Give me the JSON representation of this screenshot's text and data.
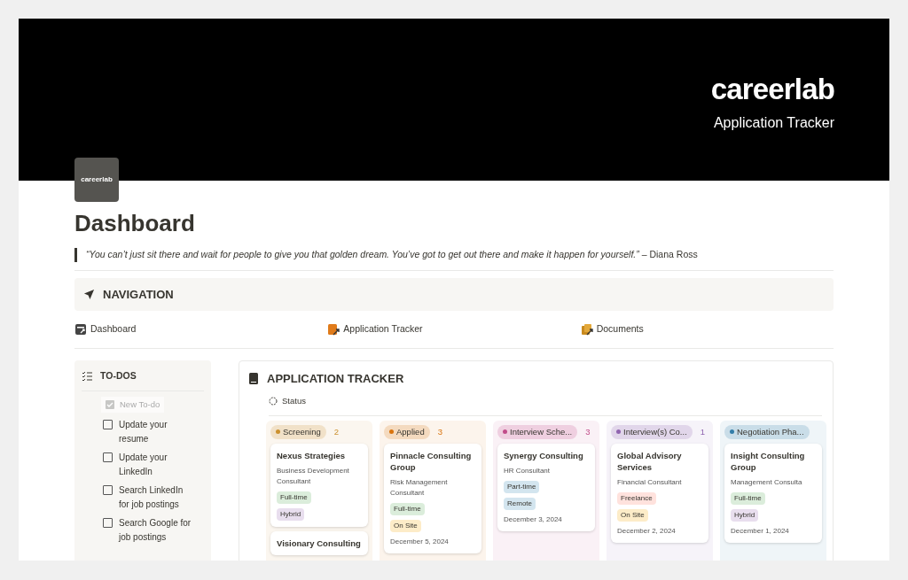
{
  "banner": {
    "brand": "careerlab",
    "subtitle": "Application Tracker"
  },
  "page_icon": {
    "label": "careerlab"
  },
  "title": "Dashboard",
  "quote": "*“You can’t just sit there and wait for people to give you that golden dream. You’ve got to get out there and make it happen for yourself.”* – Diana Ross",
  "navigation": {
    "title": "NAVIGATION",
    "links": [
      {
        "label": "Dashboard",
        "kind": "dashboard"
      },
      {
        "label": "Application Tracker",
        "kind": "tracker"
      },
      {
        "label": "Documents",
        "kind": "documents"
      }
    ]
  },
  "todos": {
    "title": "TO-DOS",
    "new_item": "New To-do",
    "items": [
      {
        "label": "Update your resume",
        "checked": false
      },
      {
        "label": "Update your LinkedIn",
        "checked": false
      },
      {
        "label": "Search LinkedIn for job postings",
        "checked": false
      },
      {
        "label": "Search Google for job postings",
        "checked": false
      }
    ]
  },
  "tracker": {
    "title": "APPLICATION TRACKER",
    "view": "Status",
    "columns": [
      {
        "label": "Screening",
        "count": "2",
        "color": "#cb912f",
        "cards": [
          {
            "company": "Nexus Strategies",
            "role": "Business Development Consultant",
            "tags": [
              {
                "label": "Full-time",
                "color": "#dbeddb"
              },
              {
                "label": "Hybrid",
                "color": "#e8deee"
              }
            ]
          },
          {
            "company": "Visionary Consulting"
          }
        ]
      },
      {
        "label": "Applied",
        "count": "3",
        "color": "#d9730d",
        "cards": [
          {
            "company": "Pinnacle Consulting Group",
            "role": "Risk Management Consultant",
            "tags": [
              {
                "label": "Full-time",
                "color": "#dbeddb"
              },
              {
                "label": "On Site",
                "color": "#fdecc8"
              }
            ],
            "date": "December 5, 2024"
          }
        ]
      },
      {
        "label": "Interview Sche...",
        "count": "3",
        "color": "#c14c8a",
        "cards": [
          {
            "company": "Synergy Consulting",
            "role": "HR Consultant",
            "tags": [
              {
                "label": "Part-time",
                "color": "#d3e5ef"
              },
              {
                "label": "Remote",
                "color": "#d3e5ef"
              }
            ],
            "date": "December 3, 2024"
          }
        ]
      },
      {
        "label": "Interview(s) Co...",
        "count": "1",
        "color": "#9065b0",
        "cards": [
          {
            "company": "Global Advisory Services",
            "role": "Financial Consultant",
            "tags": [
              {
                "label": "Freelance",
                "color": "#ffe2dd"
              },
              {
                "label": "On Site",
                "color": "#fdecc8"
              }
            ],
            "date": "December 2, 2024"
          }
        ]
      },
      {
        "label": "Negotiation Pha...",
        "color": "#337ea9",
        "cards": [
          {
            "company": "Insight Consulting Group",
            "role": "Management Consulta",
            "tags": [
              {
                "label": "Full-time",
                "color": "#dbeddb"
              },
              {
                "label": "Hybrid",
                "color": "#e8deee"
              }
            ],
            "date": "December 1, 2024"
          }
        ]
      }
    ]
  }
}
